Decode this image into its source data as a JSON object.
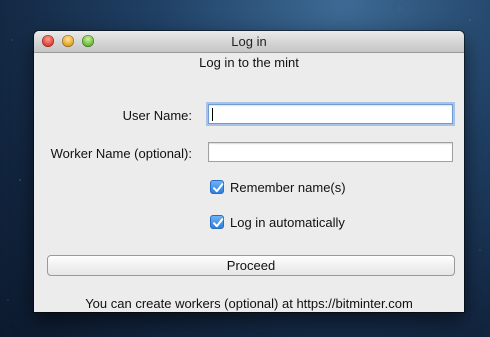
{
  "window": {
    "title": "Log in"
  },
  "form": {
    "heading": "Log in to the mint",
    "user_name_label": "User Name:",
    "user_name_value": "",
    "worker_name_label": "Worker Name (optional):",
    "worker_name_value": "",
    "remember_label": "Remember name(s)",
    "remember_checked": true,
    "auto_login_label": "Log in automatically",
    "auto_login_checked": true,
    "proceed_label": "Proceed",
    "footer_text": "You can create workers (optional) at https://bitminter.com"
  }
}
